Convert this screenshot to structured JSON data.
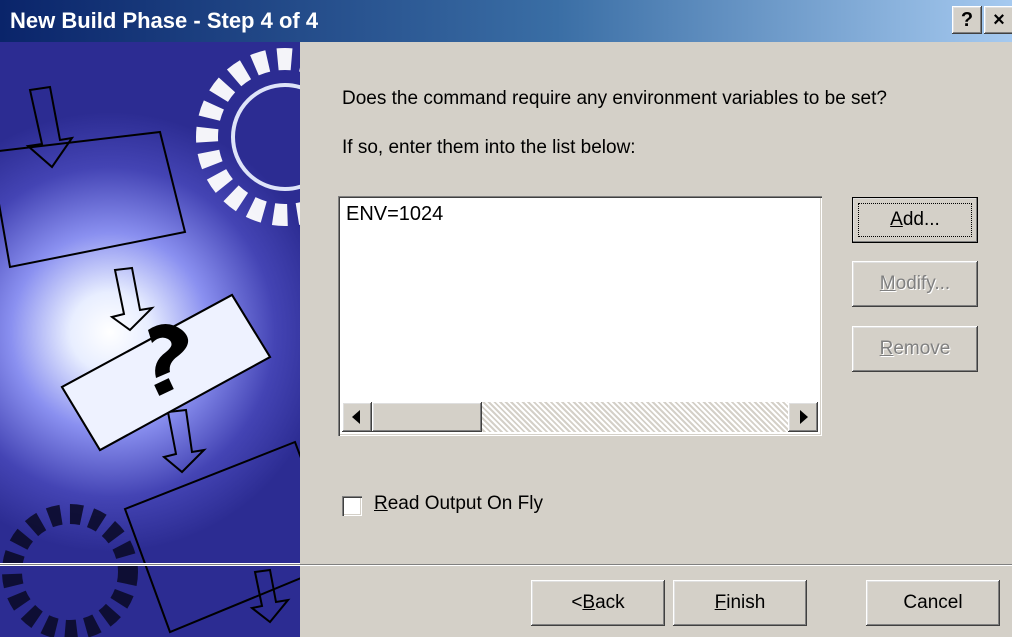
{
  "window": {
    "title": "New Build Phase - Step 4 of 4",
    "help_glyph": "?",
    "close_glyph": "×"
  },
  "prompt": {
    "question": "Does the command require any environment variables to be set?",
    "instruction": "If so, enter them into the list below:"
  },
  "env_list": {
    "items": [
      "ENV=1024"
    ]
  },
  "list_buttons": {
    "add": {
      "before": "",
      "mnemonic": "A",
      "after": "dd...",
      "enabled": true
    },
    "modify": {
      "before": "",
      "mnemonic": "M",
      "after": "odify...",
      "enabled": false
    },
    "remove": {
      "before": "",
      "mnemonic": "R",
      "after": "emove",
      "enabled": false
    }
  },
  "checkbox": {
    "mnemonic": "R",
    "label_rest": "ead Output On Fly",
    "checked": false
  },
  "footer": {
    "back": {
      "before": "< ",
      "mnemonic": "B",
      "after": "ack"
    },
    "finish": {
      "before": "",
      "mnemonic": "F",
      "after": "inish"
    },
    "cancel": {
      "before": "Cancel",
      "mnemonic": "",
      "after": ""
    }
  },
  "colors": {
    "title_start": "#0a246a",
    "title_end": "#a6caf0",
    "face": "#d4d0c8",
    "art_bg": "#2c2c92",
    "glow": "#cfe0ff"
  }
}
